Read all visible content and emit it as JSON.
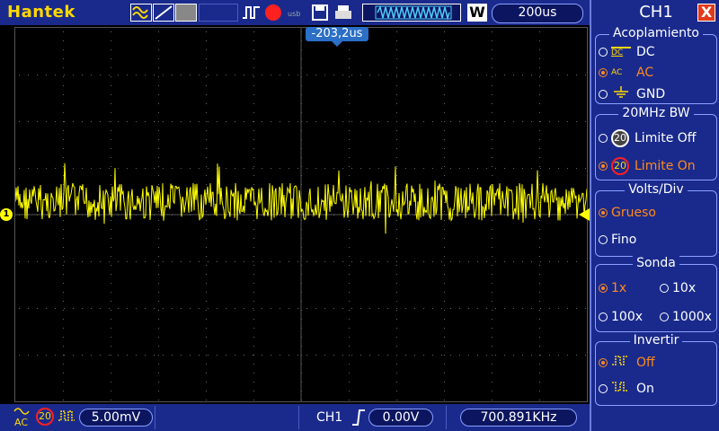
{
  "brand": "Hantek",
  "top": {
    "timebase": "200us",
    "mode_letter": "W"
  },
  "trigger_marker": {
    "time": "-203,2us"
  },
  "channel_marker": "1",
  "bottom": {
    "coupling_icon": "AC",
    "bw_icon": "20",
    "volts_div": "5.00mV",
    "trigger_source": "CH1",
    "trigger_level": "0.00V",
    "frequency": "700.891KHz"
  },
  "panel": {
    "title": "CH1",
    "close": "X",
    "coupling": {
      "label": "Acoplamiento",
      "options": [
        "DC",
        "AC",
        "GND"
      ],
      "selected": "AC",
      "icons": [
        "DC",
        "AC",
        ""
      ]
    },
    "bw": {
      "label": "20MHz  BW",
      "off_label": "Limite  Off",
      "on_label": "Limite  On",
      "badge": "20",
      "selected": "on"
    },
    "volts": {
      "label": "Volts/Div",
      "coarse": "Grueso",
      "fine": "Fino",
      "selected": "coarse"
    },
    "probe": {
      "label": "Sonda",
      "options": [
        "1x",
        "10x",
        "100x",
        "1000x"
      ],
      "selected": "1x"
    },
    "invert": {
      "label": "Invertir",
      "off": "Off",
      "on": "On",
      "selected": "off"
    }
  },
  "colors": {
    "bg_panel": "#1a2a8c",
    "trace": "#ffff00",
    "selected": "#ff8a1c"
  }
}
